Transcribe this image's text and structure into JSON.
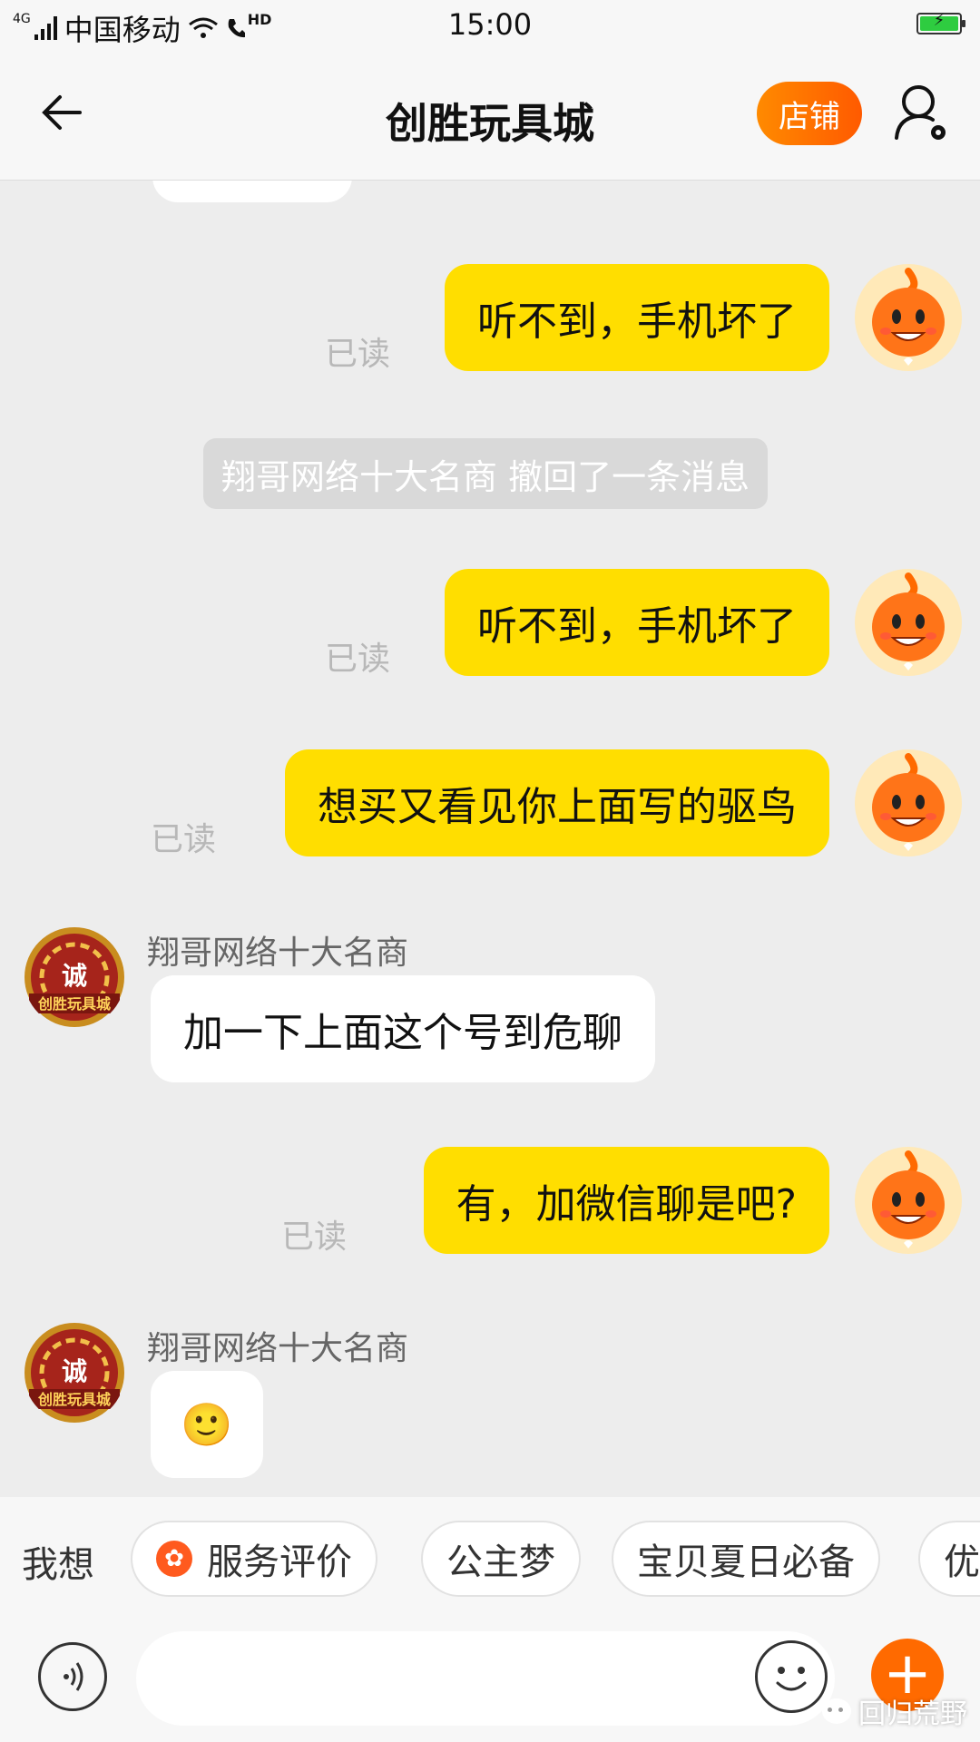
{
  "status": {
    "network_tag": "4G",
    "carrier": "中国移动",
    "hd_label": "HD",
    "time": "15:00"
  },
  "header": {
    "title": "创胜玩具城",
    "shop_button": "店铺"
  },
  "chat": {
    "messages": [
      {
        "type": "me",
        "text": "听不到，手机坏了",
        "read": "已读"
      },
      {
        "type": "system",
        "text": "翔哥网络十大名商 撤回了一条消息"
      },
      {
        "type": "me",
        "text": "听不到，手机坏了",
        "read": "已读"
      },
      {
        "type": "me",
        "text": "想买又看见你上面写的驱鸟",
        "read": "已读"
      },
      {
        "type": "other",
        "sender": "翔哥网络十大名商",
        "text": "加一下上面这个号到危聊"
      },
      {
        "type": "me",
        "text": "有，加微信聊是吧?",
        "read": "已读"
      },
      {
        "type": "other",
        "sender": "翔哥网络十大名商",
        "text": "🙂"
      }
    ],
    "shop_avatar_text": "诚",
    "shop_avatar_banner": "创胜玩具城"
  },
  "suggestions": {
    "label": "我想",
    "chips": [
      "服务评价",
      "公主梦",
      "宝贝夏日必备",
      "优"
    ]
  },
  "input": {
    "placeholder": ""
  },
  "watermark": {
    "text": "回归荒野"
  },
  "colors": {
    "bubble_me": "#ffde00",
    "bubble_other": "#ffffff",
    "accent": "#ff6a00",
    "chat_bg": "#ededed"
  }
}
